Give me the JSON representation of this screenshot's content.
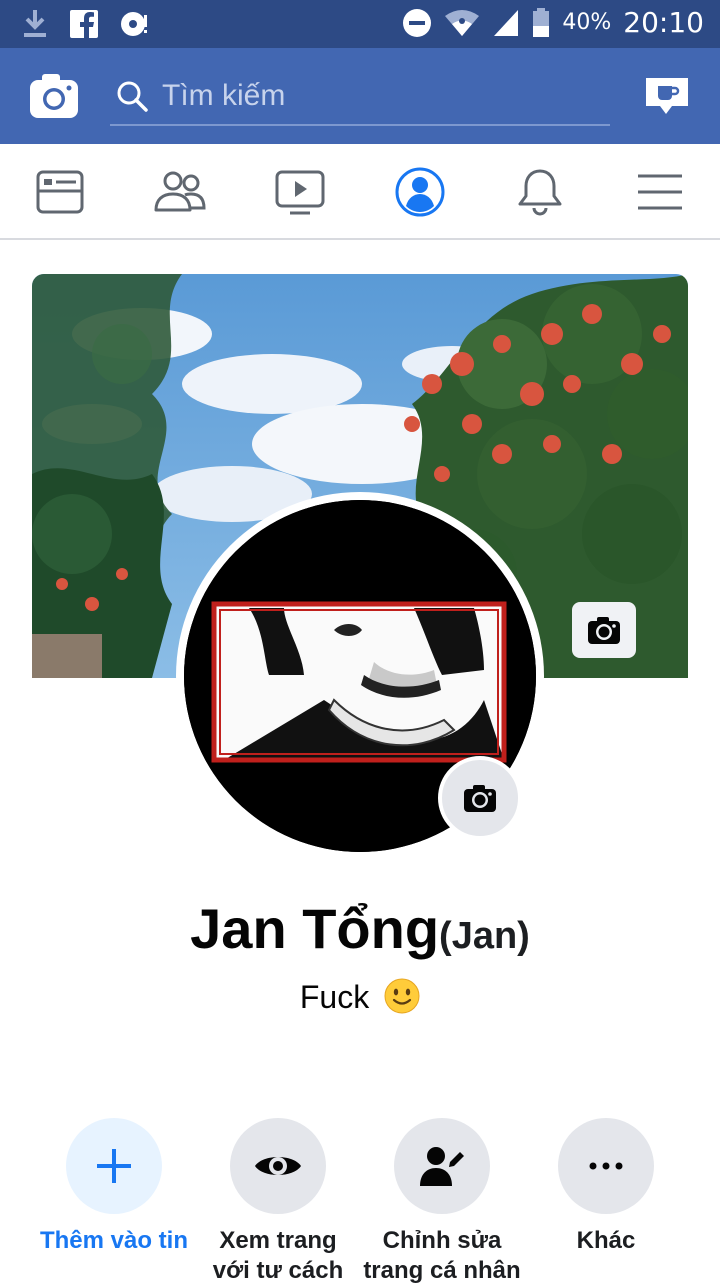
{
  "status_bar": {
    "battery_text": "40%",
    "time": "20:10",
    "icons": [
      "download-icon",
      "facebook-icon",
      "disc-icon",
      "dnd-icon",
      "wifi-icon",
      "signal-icon",
      "battery-icon"
    ]
  },
  "app_bar": {
    "search_placeholder": "Tìm kiếm",
    "color": "#4267b2"
  },
  "tabs": [
    {
      "name": "news-feed",
      "icon": "newsfeed-icon",
      "active": false
    },
    {
      "name": "friends",
      "icon": "friends-icon",
      "active": false
    },
    {
      "name": "watch",
      "icon": "video-icon",
      "active": false
    },
    {
      "name": "profile",
      "icon": "profile-icon",
      "active": true
    },
    {
      "name": "notifications",
      "icon": "bell-icon",
      "active": false
    },
    {
      "name": "menu",
      "icon": "menu-icon",
      "active": false
    }
  ],
  "profile": {
    "name": "Jan Tổng",
    "alternate_name": "(Jan)",
    "bio": "Fuck",
    "bio_emoji": "slightly-smiling-face"
  },
  "actions": [
    {
      "label_line1": "Thêm vào tin",
      "label_line2": "",
      "icon": "plus-icon"
    },
    {
      "label_line1": "Xem trang",
      "label_line2": "với tư cách",
      "icon": "eye-icon"
    },
    {
      "label_line1": "Chỉnh sửa",
      "label_line2": "trang cá nhân",
      "icon": "edit-profile-icon"
    },
    {
      "label_line1": "Khác",
      "label_line2": "",
      "icon": "more-icon"
    }
  ],
  "colors": {
    "accent": "#1877f2",
    "status_bar": "#2d4a85"
  }
}
